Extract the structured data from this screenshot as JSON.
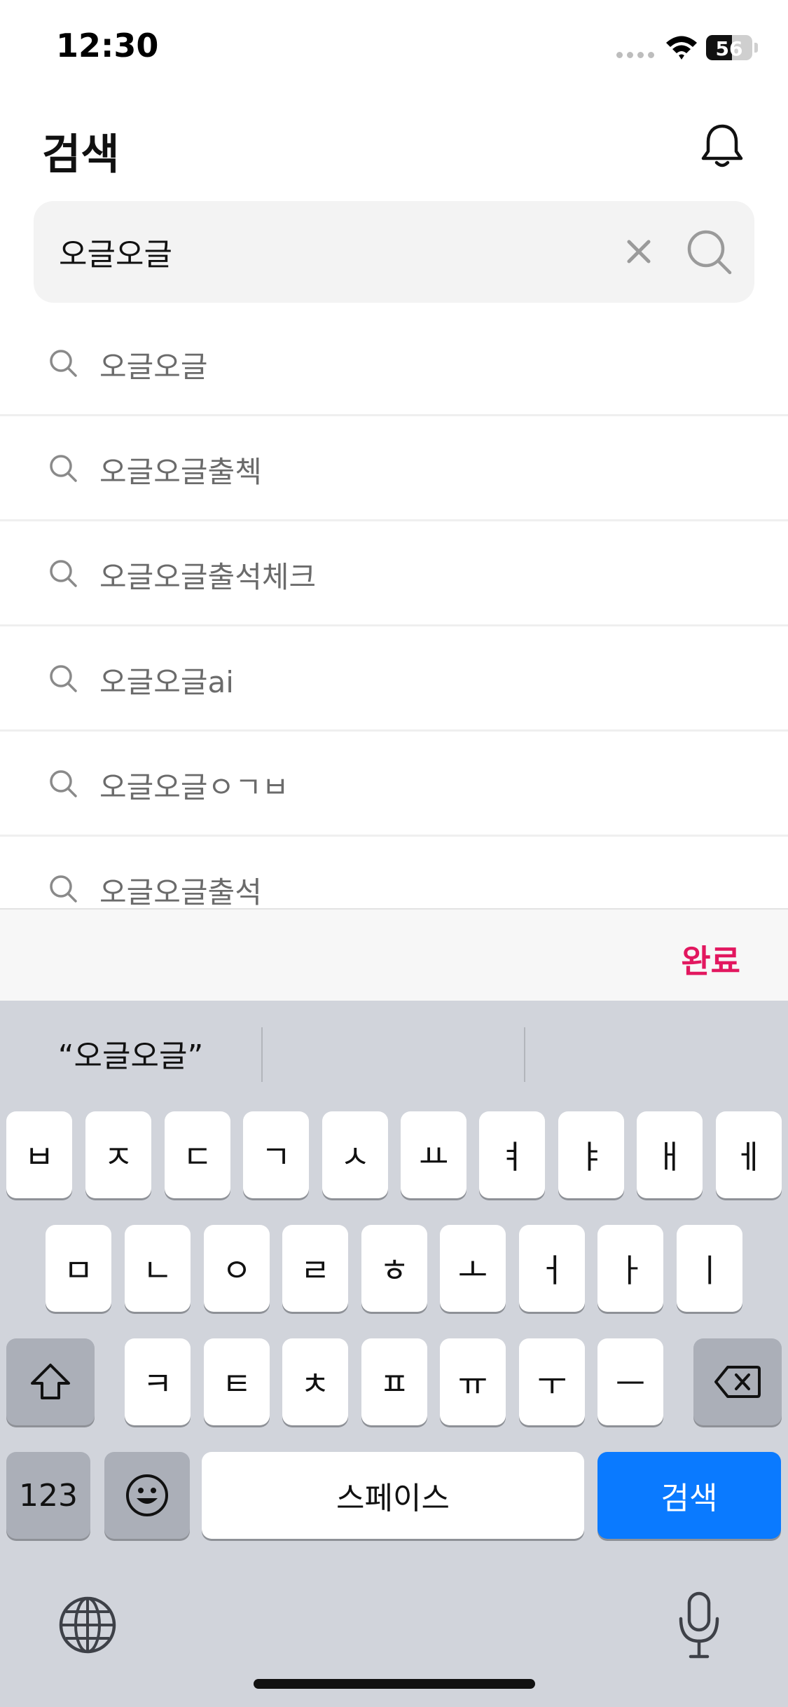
{
  "status_bar": {
    "time": "12:30",
    "battery": "56",
    "battery_level": 0.56
  },
  "header": {
    "title": "검색"
  },
  "search": {
    "value": "오글오글"
  },
  "suggestions": [
    "오글오글",
    "오글오글출첵",
    "오글오글출석체크",
    "오글오글ai",
    "오글오글ㅇㄱㅂ",
    "오글오글출석"
  ],
  "done_label": "완료",
  "predictions": [
    "“오글오글”",
    "",
    ""
  ],
  "keyboard": {
    "row1": [
      "ㅂ",
      "ㅈ",
      "ㄷ",
      "ㄱ",
      "ㅅ",
      "ㅛ",
      "ㅕ",
      "ㅑ",
      "ㅐ",
      "ㅔ"
    ],
    "row2": [
      "ㅁ",
      "ㄴ",
      "ㅇ",
      "ㄹ",
      "ㅎ",
      "ㅗ",
      "ㅓ",
      "ㅏ",
      "ㅣ"
    ],
    "row3": [
      "ㅋ",
      "ㅌ",
      "ㅊ",
      "ㅍ",
      "ㅠ",
      "ㅜ",
      "ㅡ"
    ],
    "numbers_label": "123",
    "space_label": "스페이스",
    "search_label": "검색"
  },
  "colors": {
    "accent": "#e2175f",
    "keyboard_blue": "#0a7aff",
    "keyboard_bg": "#d1d4db"
  },
  "icons": [
    "wifi-icon",
    "bell-icon",
    "clear-icon",
    "search-icon",
    "shift-icon",
    "backspace-icon",
    "emoji-icon",
    "globe-icon",
    "microphone-icon"
  ]
}
